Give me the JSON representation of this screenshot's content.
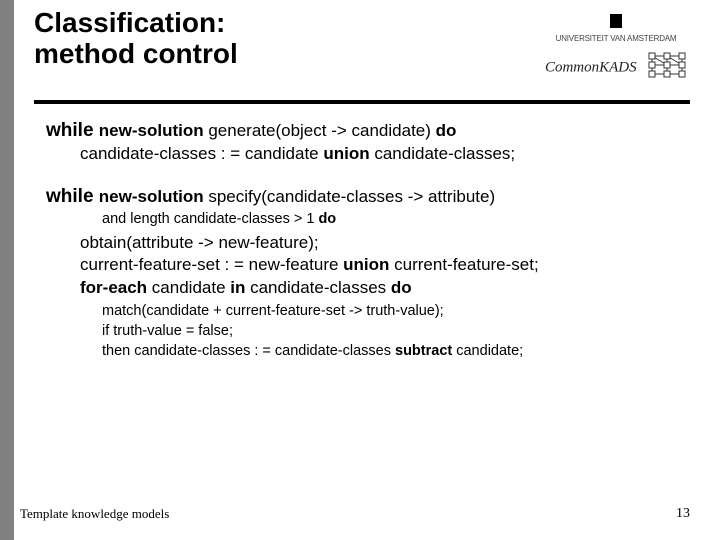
{
  "header": {
    "title_line1": "Classification:",
    "title_line2": "method control",
    "uni_label": "UNIVERSITEIT VAN AMSTERDAM",
    "kads_label": "CommonKADS"
  },
  "code": {
    "l1_while": "while ",
    "l1_ns": "new-solution",
    "l1_rest": " generate(object -> candidate) ",
    "l1_do": "do",
    "l2_a": "candidate-classes : = candidate ",
    "l2_union": "union",
    "l2_b": " candidate-classes;",
    "l3_while": "while ",
    "l3_ns": "new-solution",
    "l3_rest": " specify(candidate-classes -> attribute)",
    "l4_a": "and length candidate-classes > 1 ",
    "l4_do": "do",
    "l5": "obtain(attribute -> new-feature);",
    "l6_a": "current-feature-set : = new-feature ",
    "l6_union": "union",
    "l6_b": " current-feature-set;",
    "l7_fe": "for-each",
    "l7_mid": " candidate ",
    "l7_in": "in",
    "l7_rest": " candidate-classes ",
    "l7_do": "do",
    "l8": "match(candidate + current-feature-set -> truth-value);",
    "l9": "if truth-value = false;",
    "l10_a": "then candidate-classes : = candidate-classes ",
    "l10_sub": "subtract",
    "l10_b": " candidate;"
  },
  "footer": {
    "left": "Template knowledge models",
    "right": "13"
  }
}
